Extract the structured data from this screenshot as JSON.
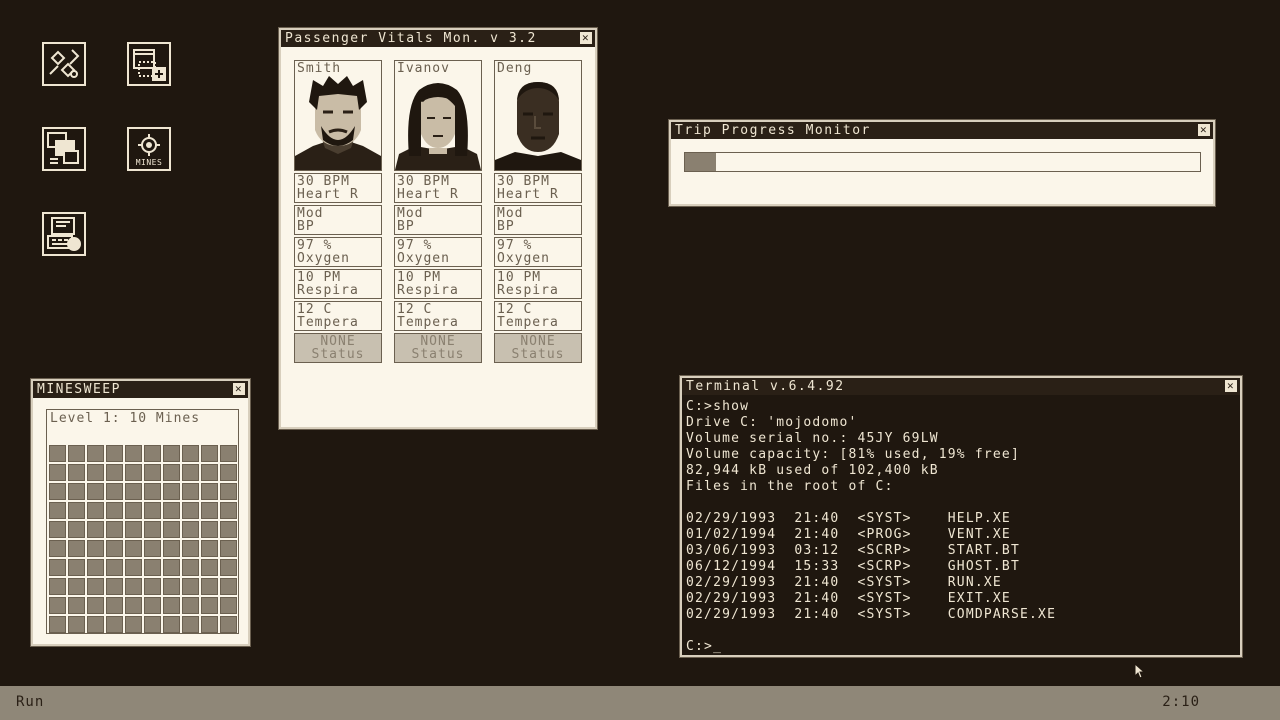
{
  "desktop_icons": [
    {
      "name": "network-map-icon"
    },
    {
      "name": "medical-folder-icon"
    },
    {
      "name": "windows-stack-icon"
    },
    {
      "name": "mines-app-icon",
      "label": "MINES"
    },
    {
      "name": "computer-disk-icon"
    }
  ],
  "vitals": {
    "title": "Passenger Vitals Mon. v 3.2",
    "passengers": [
      {
        "name": "Smith",
        "heart_value": "30 BPM",
        "heart_label": "Heart R",
        "bp_value": "Mod",
        "bp_label": "BP",
        "oxy_value": "97 %",
        "oxy_label": "Oxygen",
        "resp_value": "10 PM",
        "resp_label": "Respira",
        "temp_value": "12 C",
        "temp_label": "Tempera",
        "status_value": "NONE",
        "status_label": "Status"
      },
      {
        "name": "Ivanov",
        "heart_value": "30 BPM",
        "heart_label": "Heart R",
        "bp_value": "Mod",
        "bp_label": "BP",
        "oxy_value": "97 %",
        "oxy_label": "Oxygen",
        "resp_value": "10 PM",
        "resp_label": "Respira",
        "temp_value": "12 C",
        "temp_label": "Tempera",
        "status_value": "NONE",
        "status_label": "Status"
      },
      {
        "name": "Deng",
        "heart_value": "30 BPM",
        "heart_label": "Heart R",
        "bp_value": "Mod",
        "bp_label": "BP",
        "oxy_value": "97 %",
        "oxy_label": "Oxygen",
        "resp_value": "10 PM",
        "resp_label": "Respira",
        "temp_value": "12 C",
        "temp_label": "Tempera",
        "status_value": "NONE",
        "status_label": "Status"
      }
    ]
  },
  "trip": {
    "title": "Trip Progress Monitor",
    "progress": 0.06
  },
  "minesweep": {
    "title": "MINESWEEP",
    "level": "Level 1: 10 Mines",
    "rows": 10,
    "cols": 10
  },
  "terminal": {
    "title": "Terminal v.6.4.92",
    "lines": [
      "C:>show",
      "Drive C: 'mojodomo'",
      "Volume serial no.: 45JY 69LW",
      "Volume capacity: [81% used, 19% free]",
      "82,944 kB used of 102,400 kB",
      "Files in the root of C:",
      "",
      "02/29/1993  21:40  <SYST>    HELP.XE",
      "01/02/1994  21:40  <PROG>    VENT.XE",
      "03/06/1993  03:12  <SCRP>    START.BT",
      "06/12/1994  15:33  <SCRP>    GHOST.BT",
      "02/29/1993  21:40  <SYST>    RUN.XE",
      "02/29/1993  21:40  <SYST>    EXIT.XE",
      "02/29/1993  21:40  <SYST>    COMDPARSE.XE",
      "",
      "C:>_"
    ]
  },
  "taskbar": {
    "run_label": "Run",
    "clock": "2:10"
  },
  "colors": {
    "background": "#1f170f",
    "window": "#fbf6ea",
    "accent": "#8a8070",
    "taskbar": "#8f8778"
  }
}
